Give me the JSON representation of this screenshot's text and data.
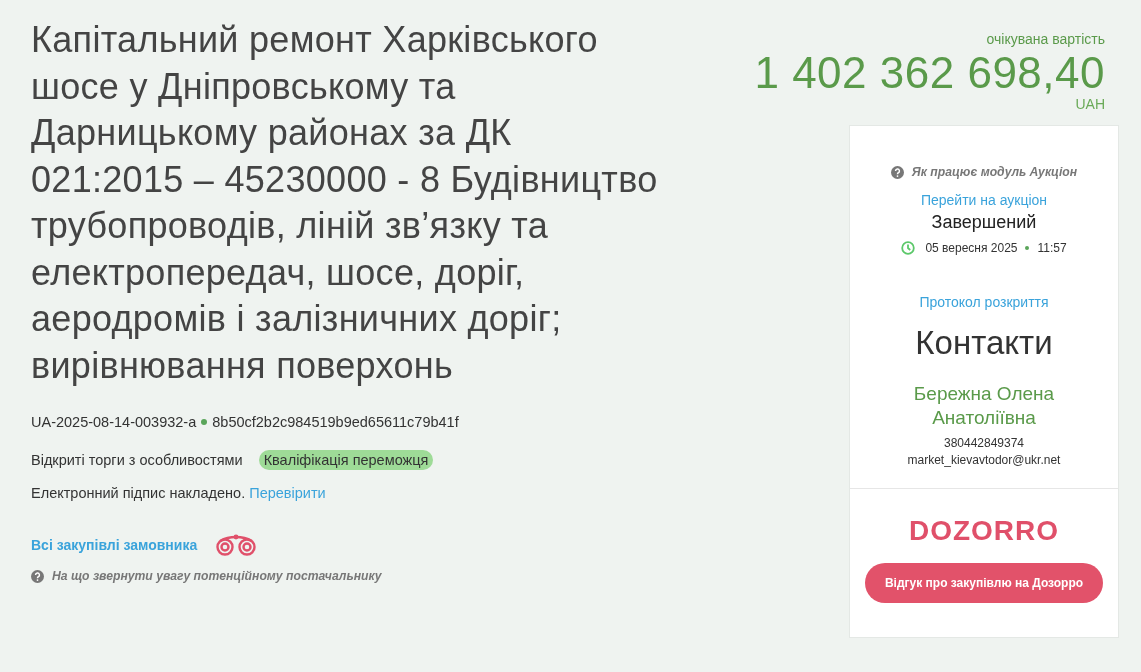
{
  "tender": {
    "title": "Капітальний ремонт Харківського шосе у Дніпровському та Дарницькому районах за ДК 021:2015 – 45230000 - 8 Будівництво трубопроводів, ліній зв’язку та електропередач, шосе, доріг, аеродромів і залізничних доріг; вирівнювання поверхонь",
    "tender_id": "UA-2025-08-14-003932-a",
    "hash": "8b50cf2b2c984519b9ed65611c79b41f",
    "procedure_type": "Відкриті торги з особливостями",
    "status": "Кваліфікація переможця",
    "signature": {
      "text": "Електронний підпис накладено.",
      "link": "Перевірити"
    },
    "customer_link": "Всі закупівлі замовника",
    "supplier_help": "На що звернути увагу потенційному постачальнику"
  },
  "price": {
    "label": "очікувана вартість",
    "amount": "1 402 362 698,40",
    "currency": "UAH"
  },
  "auction": {
    "help": "Як працює модуль Аукціон",
    "link": "Перейти на аукціон",
    "status": "Завершений",
    "date": "05 вересня 2025",
    "time": "11:57"
  },
  "protocol_link": "Протокол розкриття",
  "contacts": {
    "title": "Контакти",
    "name": "Бережна Олена Анатоліївна",
    "phone": "380442849374",
    "email": "market_kievavtodor@ukr.net"
  },
  "dozorro": {
    "logo": "DOZORRO",
    "button": "Відгук про закупівлю на Дозорро"
  }
}
